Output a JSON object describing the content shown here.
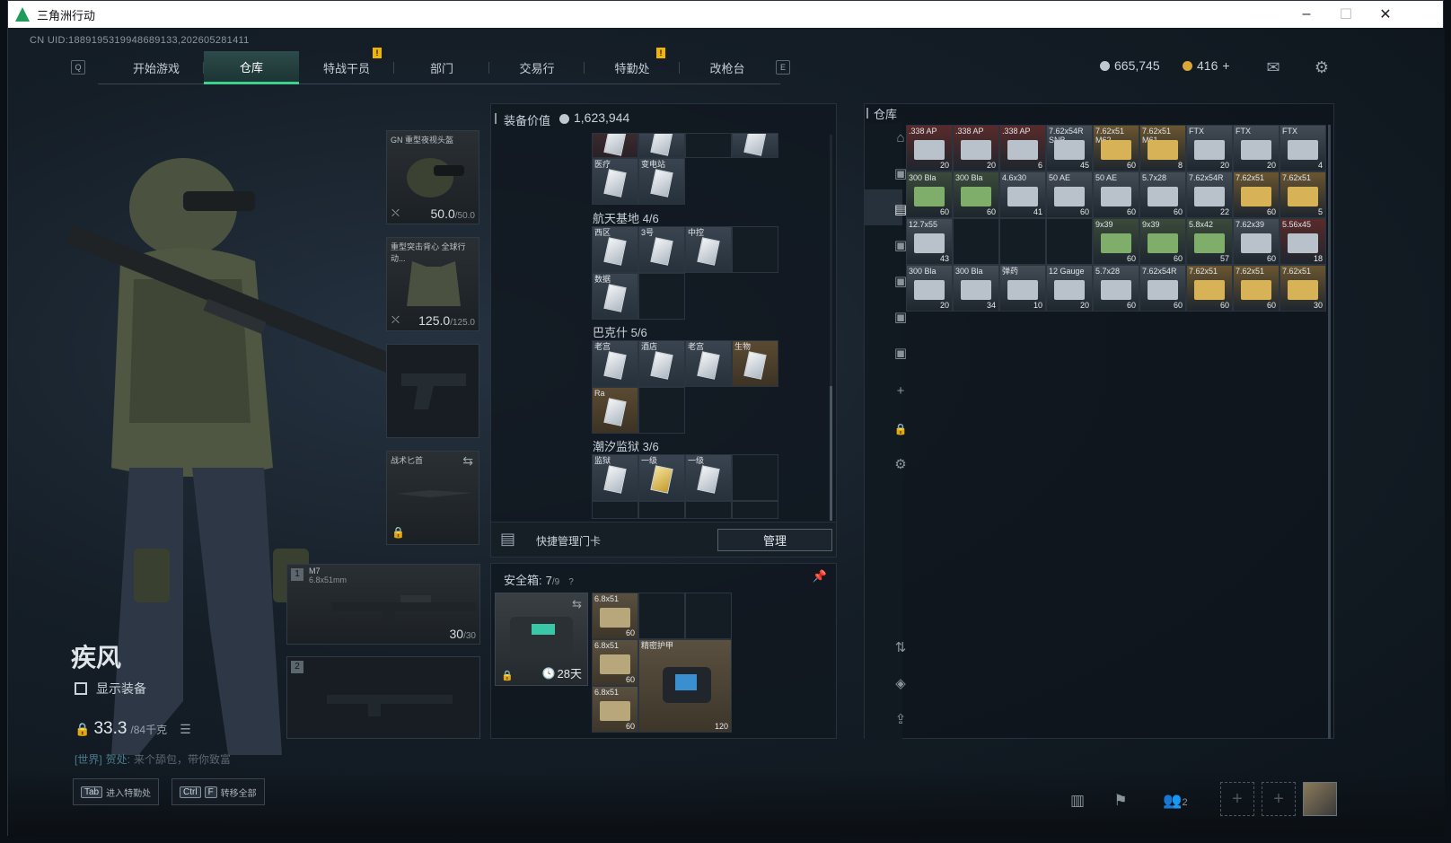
{
  "window": {
    "title": "三角洲行动",
    "min": "–",
    "max": "☐",
    "close": "✕"
  },
  "uid": "CN UID:1889195319948689133,202605281411",
  "nav": {
    "key_left": "Q",
    "key_right": "E",
    "tabs": [
      "开始游戏",
      "仓库",
      "特战干员",
      "部门",
      "交易行",
      "特勤处",
      "改枪台"
    ],
    "notif": "!"
  },
  "currency": {
    "coins": "665,745",
    "gold": "416",
    "plus": "+"
  },
  "operator": {
    "name": "疾风",
    "show_gear": "显示装备",
    "weight": "33.3",
    "weight_max": "/84千克",
    "chat_channel": "[世界]",
    "chat_user": "贺处:",
    "chat_msg": "来个舔包，带你致富"
  },
  "slots": {
    "helmet": {
      "label": "GN 重型夜视头盔",
      "value": "50.0",
      "max": "/50.0"
    },
    "armor": {
      "label": "重型突击背心 全球行动...",
      "value": "125.0",
      "max": "/125.0"
    },
    "knife": {
      "label": "战术匕首"
    },
    "primary": {
      "index": "1",
      "name": "M7",
      "caliber": "6.8x51mm",
      "ammo": "30",
      "ammo_max": "/30"
    },
    "secondary": {
      "index": "2"
    }
  },
  "gear_value": {
    "label": "装备价值",
    "value": "1,623,944"
  },
  "keycards": {
    "top_labels": [
      "",
      "",
      "",
      "医疗",
      "变电站"
    ],
    "aerospace": {
      "title": "航天基地",
      "count": "4/6",
      "items": [
        "西区",
        "3号",
        "中控",
        "数据"
      ]
    },
    "bakesh": {
      "title": "巴克什",
      "count": "5/6",
      "items": [
        "老宫",
        "酒店",
        "老宫",
        "生物",
        "Ra"
      ]
    },
    "tidal": {
      "title": "潮汐监狱",
      "count": "3/6",
      "items": [
        "监狱",
        "一级",
        "一级"
      ]
    },
    "quick_manage": "快捷管理门卡",
    "manage_btn": "管理"
  },
  "safebox": {
    "label": "安全箱:",
    "count": "7",
    "max": "/9",
    "help": "?",
    "timer": "28天",
    "items": [
      {
        "name": "6.8x51",
        "count": "60"
      },
      {
        "name": "6.8x51",
        "count": "60"
      },
      {
        "name": "6.8x51",
        "count": "60"
      },
      {
        "name": "精密护甲",
        "count": "120"
      }
    ]
  },
  "warehouse": {
    "title": "仓库",
    "items": [
      {
        "n": ".338 AP",
        "c": "20",
        "col": "#5a2a2a"
      },
      {
        "n": ".338 AP",
        "c": "20",
        "col": "#5a2a2a"
      },
      {
        "n": ".338 AP",
        "c": "6",
        "col": "#5a2a2a"
      },
      {
        "n": "7.62x54R SNB",
        "c": "45",
        "col": "#434b55"
      },
      {
        "n": "7.62x51 M62",
        "c": "60",
        "col": "#6a5530"
      },
      {
        "n": "7.62x51 M61",
        "c": "8",
        "col": "#6a5530"
      },
      {
        "n": "FTX",
        "c": "20",
        "col": "#434b55"
      },
      {
        "n": "FTX",
        "c": "20",
        "col": "#434b55"
      },
      {
        "n": "FTX",
        "c": "4",
        "col": "#434b55"
      },
      {
        "n": "300 Bla",
        "c": "60",
        "col": "#3a4a3a"
      },
      {
        "n": "300 Bla",
        "c": "60",
        "col": "#3a4a3a"
      },
      {
        "n": "4.6x30",
        "c": "41",
        "col": "#434b55"
      },
      {
        "n": "50 AE",
        "c": "60",
        "col": "#434b55"
      },
      {
        "n": "50 AE",
        "c": "60",
        "col": "#434b55"
      },
      {
        "n": "5.7x28",
        "c": "60",
        "col": "#434b55"
      },
      {
        "n": "7.62x54R",
        "c": "22",
        "col": "#434b55"
      },
      {
        "n": "7.62x51",
        "c": "60",
        "col": "#6a5530"
      },
      {
        "n": "7.62x51",
        "c": "5",
        "col": "#6a5530"
      },
      {
        "n": "12.7x55",
        "c": "43",
        "col": "#434b55"
      },
      {
        "n": "",
        "c": "",
        "col": ""
      },
      {
        "n": "",
        "c": "",
        "col": ""
      },
      {
        "n": "",
        "c": "",
        "col": ""
      },
      {
        "n": "9x39",
        "c": "60",
        "col": "#3a4a3a"
      },
      {
        "n": "9x39",
        "c": "60",
        "col": "#3a4a3a"
      },
      {
        "n": "5.8x42",
        "c": "57",
        "col": "#3a4a3a"
      },
      {
        "n": "7.62x39",
        "c": "60",
        "col": "#434b55"
      },
      {
        "n": "5.56x45",
        "c": "18",
        "col": "#5a2a2a"
      },
      {
        "n": "300 Bla",
        "c": "20",
        "col": "#434b55"
      },
      {
        "n": "300 Bla",
        "c": "34",
        "col": "#434b55"
      },
      {
        "n": "弹药",
        "c": "10",
        "col": "#434b55"
      },
      {
        "n": "12 Gauge",
        "c": "20",
        "col": "#434b55"
      },
      {
        "n": "5.7x28",
        "c": "60",
        "col": "#434b55"
      },
      {
        "n": "7.62x54R",
        "c": "60",
        "col": "#434b55"
      },
      {
        "n": "7.62x51",
        "c": "60",
        "col": "#6a5530"
      },
      {
        "n": "7.62x51",
        "c": "60",
        "col": "#6a5530"
      },
      {
        "n": "7.62x51",
        "c": "30",
        "col": "#6a5530"
      }
    ]
  },
  "hints": {
    "tab_key": "Tab",
    "tab_label": "进入特勤处",
    "ctrl_key": "Ctrl",
    "f_key": "F",
    "ctrl_label": "转移全部"
  },
  "bottom": {
    "squad_count": "2"
  },
  "colors": {
    "accent": "#3bd18f",
    "notif": "#f0b500"
  }
}
